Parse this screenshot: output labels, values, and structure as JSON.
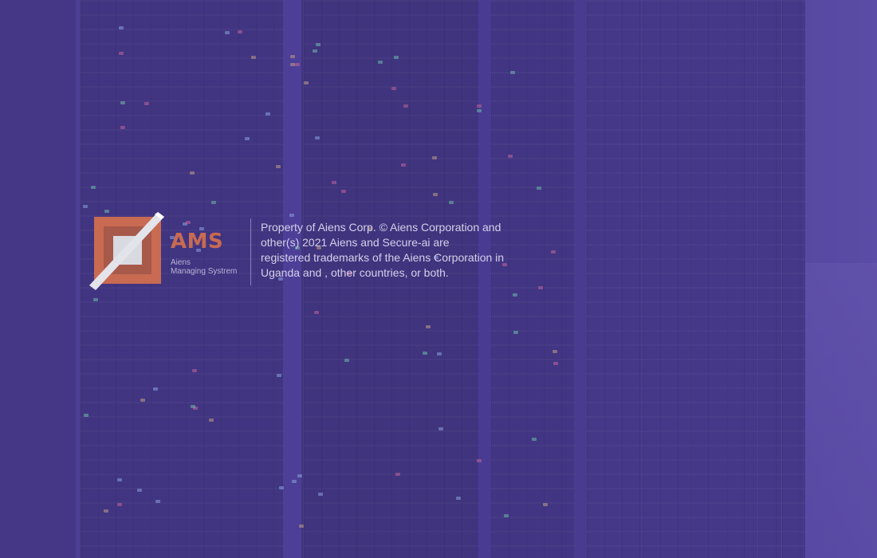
{
  "brand": {
    "logo_icon": "ams-square-diagonal-icon",
    "name": "AMS",
    "company": "Aiens",
    "product": "Managing Systrem",
    "colors": {
      "logo_red": "#c96a52",
      "logo_silver": "#d9d9e0",
      "subtext": "#b9b2d6"
    }
  },
  "legal": {
    "lines": [
      "Property of Aiens Corp. © Aiens Corporation and",
      "other(s) 2021 Aiens and Secure-ai are",
      "registered trademarks of the Aiens Corporation in",
      "Uganda and , other countries, or both."
    ]
  },
  "theme": {
    "overlay_color": "#503ea0",
    "background": "server-room"
  }
}
